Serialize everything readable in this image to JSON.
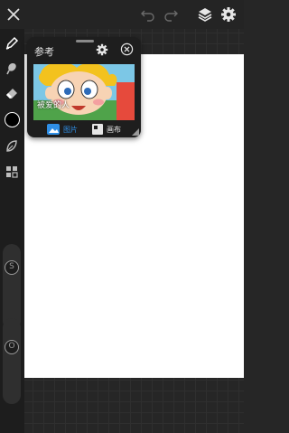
{
  "reference_panel": {
    "title": "参考",
    "image_caption": "被爱的人",
    "tabs": [
      {
        "label": "图片",
        "active": true
      },
      {
        "label": "画布",
        "active": false
      }
    ]
  },
  "sliders": {
    "size_label": "S",
    "opacity_label": "O"
  },
  "colors": {
    "accent": "#2f8fe6",
    "current_color": "#000000",
    "canvas": "#ffffff"
  },
  "icons": [
    "close-icon",
    "undo-icon",
    "redo-icon",
    "layers-icon",
    "settings-icon",
    "brush-icon",
    "smudge-icon",
    "eraser-icon",
    "color-swatch",
    "selection-icon",
    "transform-icon"
  ]
}
